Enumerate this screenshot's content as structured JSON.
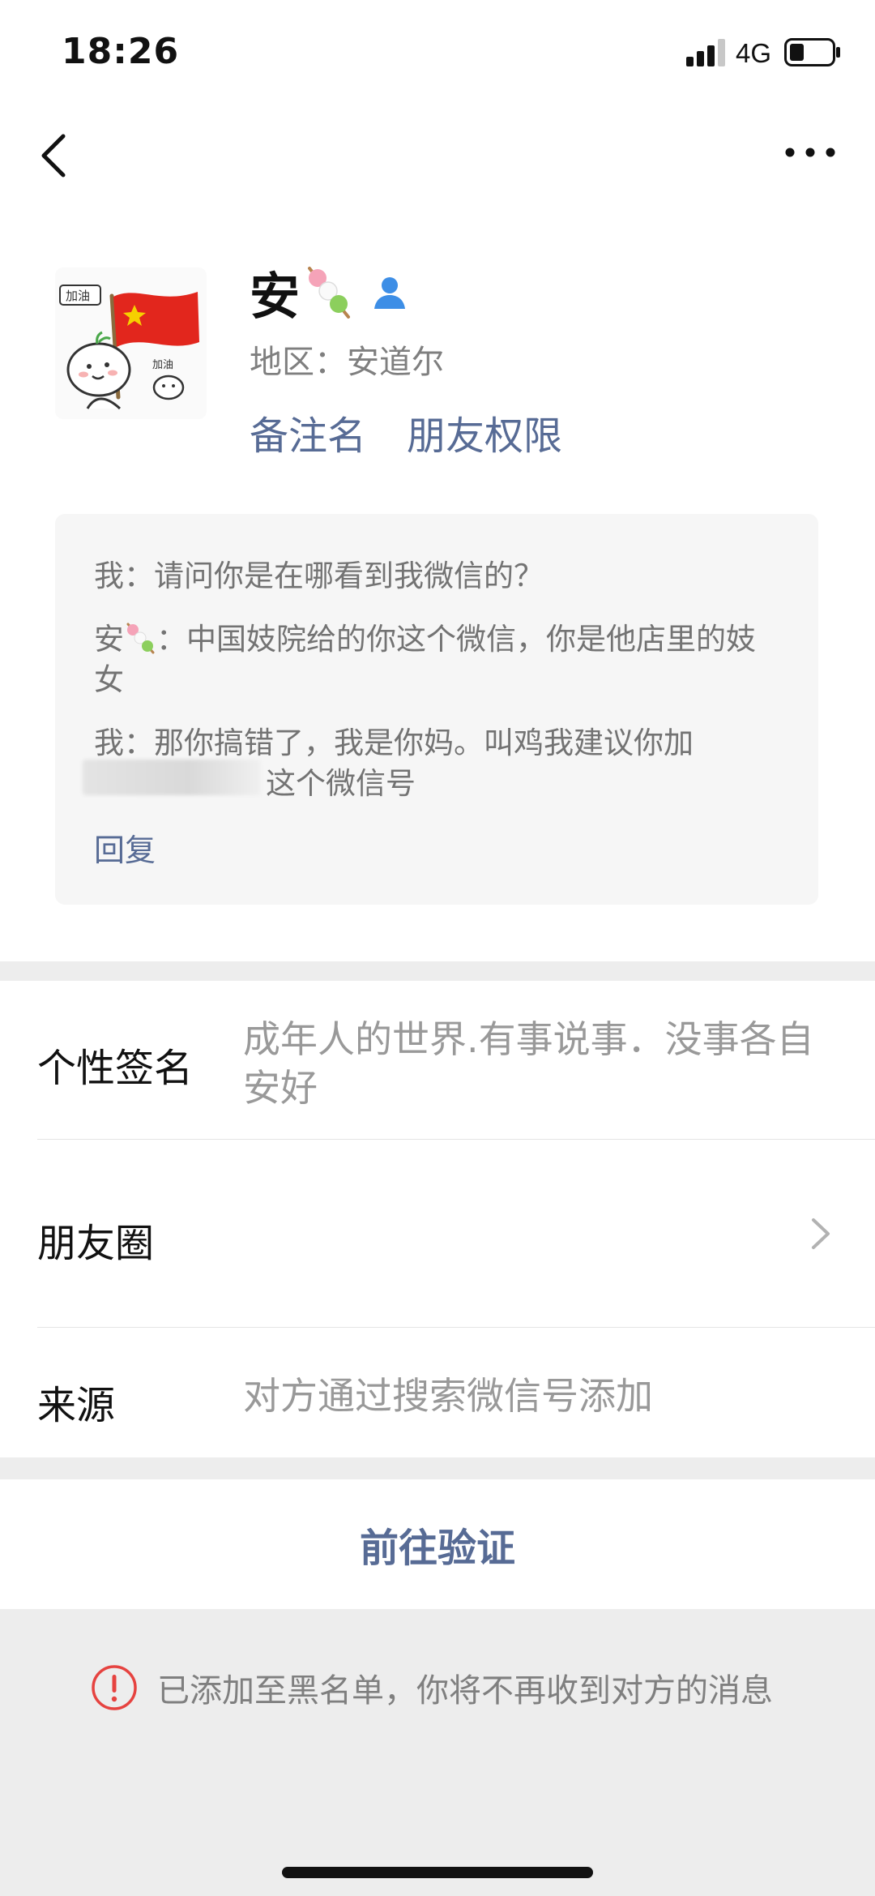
{
  "status_bar": {
    "time": "18:26",
    "network": "4G",
    "battery_icon": "battery-icon",
    "signal_icon": "signal-bars-icon"
  },
  "nav": {
    "back_icon": "chevron-left-icon",
    "more_icon": "more-dots-icon"
  },
  "profile": {
    "name": "安",
    "region": "地区：安道尔",
    "links": {
      "remark": "备注名",
      "permissions": "朋友权限"
    },
    "gender_icon": "male-person-icon",
    "accent_color": "#576b95"
  },
  "greeting": {
    "m1": "我：请问你是在哪看到我微信的？",
    "m2_prefix": "安",
    "m2_text": "：中国妓院给的你这个微信，你是他店里的妓女",
    "m3_line1": "我：那你搞错了，我是你妈。叫鸡我建议你加",
    "m3_line2": "这个微信号",
    "reply": "回复"
  },
  "rows": {
    "signature": {
      "label": "个性签名",
      "value": "成年人的世界.有事说事．没事各自安好"
    },
    "moments": {
      "label": "朋友圈"
    },
    "source": {
      "label": "来源",
      "value": "对方通过搜索微信号添加"
    }
  },
  "verify_button": "前往验证",
  "blocked_notice": "已添加至黑名单，你将不再收到对方的消息",
  "warn_color": "#e64340"
}
